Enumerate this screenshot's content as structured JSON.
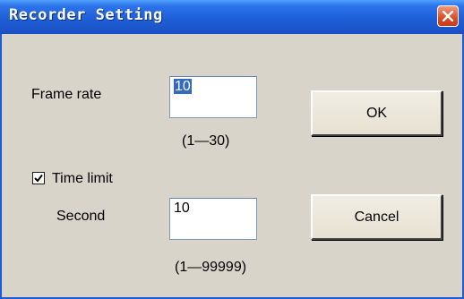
{
  "window": {
    "title": "Recorder Setting"
  },
  "frame_rate": {
    "label": "Frame rate",
    "value": "10",
    "range": "(1—30)"
  },
  "time_limit": {
    "label": "Time limit",
    "checked": true,
    "second_label": "Second",
    "second_value": "10",
    "range": "(1—99999)"
  },
  "buttons": {
    "ok": "OK",
    "cancel": "Cancel"
  },
  "icons": {
    "close": "close-icon",
    "check": "checkmark-icon"
  },
  "colors": {
    "titlebar": "#1f5fd8",
    "dialog_bg": "#d8d4c9",
    "close_button": "#dd4a25",
    "selection": "#316ac5"
  }
}
